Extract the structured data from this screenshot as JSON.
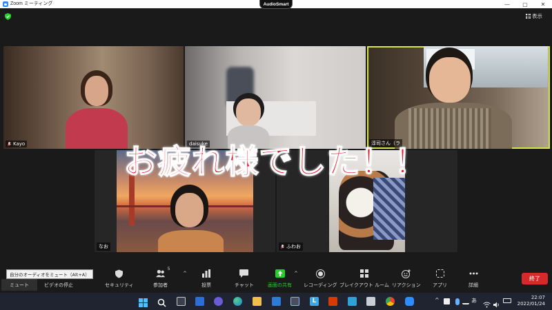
{
  "window": {
    "title": "Zoom ミーティング",
    "min": "—",
    "max": "▢",
    "close": "✕"
  },
  "audiosmart": "AudioSmart",
  "view_button": {
    "label": "表示"
  },
  "participants": [
    {
      "name": "Kayo",
      "muted": true
    },
    {
      "name": "daisuke",
      "muted": false
    },
    {
      "name": "淳司さん（ラ",
      "muted": false,
      "active_speaker": true
    },
    {
      "name": "なお",
      "muted": false
    },
    {
      "name": "ふわお",
      "muted": true
    }
  ],
  "overlay_caption": "お疲れ様でした！！",
  "tooltip": "自分のオーディオをミュート（Alt+A）",
  "toolbar": {
    "mute": "ミュート",
    "video": "ビデオの停止",
    "security": "セキュリティ",
    "participants": "参加者",
    "participants_count": "5",
    "polls": "投票",
    "chat": "チャット",
    "share": "画面の共有",
    "record": "レコーディング",
    "breakout": "ブレイクアウト ルーム",
    "reactions": "リアクション",
    "apps": "アプリ",
    "more": "詳細",
    "end": "終了"
  },
  "taskbar": {
    "ime": "あ",
    "time": "22:07",
    "date": "2022/01/24"
  },
  "colors": {
    "active_outline": "#d4e84a",
    "end_button": "#d42a2a",
    "share_green": "#24d12b",
    "caption_red": "#e8172a"
  }
}
